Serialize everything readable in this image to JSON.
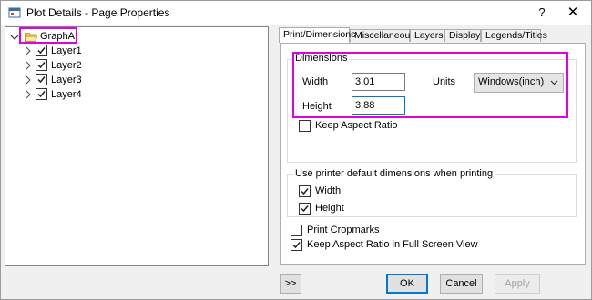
{
  "window": {
    "title": "Plot Details - Page Properties",
    "help": "?",
    "close": "✕"
  },
  "tree": {
    "root": {
      "label": "GraphA",
      "icon": "folder-open-icon"
    },
    "layers": [
      {
        "label": "Layer1",
        "checked": true
      },
      {
        "label": "Layer2",
        "checked": true
      },
      {
        "label": "Layer3",
        "checked": true
      },
      {
        "label": "Layer4",
        "checked": true
      }
    ]
  },
  "tabs": [
    {
      "label": "Print/Dimensions",
      "active": true
    },
    {
      "label": "Miscellaneous",
      "active": false
    },
    {
      "label": "Layers",
      "active": false
    },
    {
      "label": "Display",
      "active": false
    },
    {
      "label": "Legends/Titles",
      "active": false
    }
  ],
  "dimensions": {
    "group_label": "Dimensions",
    "width_label": "Width",
    "width_value": "3.01",
    "height_label": "Height",
    "height_value": "3.88",
    "units_label": "Units",
    "units_value": "Windows(inch)",
    "keep_aspect_label": "Keep Aspect Ratio",
    "keep_aspect_checked": false
  },
  "printer": {
    "group_label": "Use printer default dimensions when printing",
    "width_label": "Width",
    "width_checked": true,
    "height_label": "Height",
    "height_checked": true
  },
  "print_cropmarks": {
    "label": "Print Cropmarks",
    "checked": false
  },
  "keep_aspect_fullscreen": {
    "label": "Keep Aspect Ratio in Full Screen View",
    "checked": true
  },
  "buttons": {
    "collapse": ">>",
    "ok": "OK",
    "cancel": "Cancel",
    "apply": "Apply"
  }
}
